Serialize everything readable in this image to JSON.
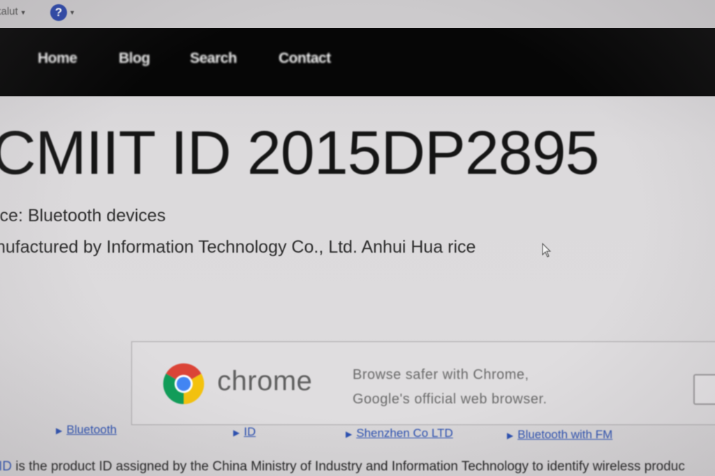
{
  "topbar": {
    "user_menu_label": "kalut",
    "help_icon_glyph": "?"
  },
  "nav": {
    "items": [
      {
        "label": "Home"
      },
      {
        "label": "Blog"
      },
      {
        "label": "Search"
      },
      {
        "label": "Contact"
      }
    ]
  },
  "main": {
    "title": "CMIIT ID 2015DP2895",
    "device_line": "ice: Bluetooth devices",
    "manufacturer_line": "nufactured by Information Technology Co., Ltd. Anhui Hua rice"
  },
  "ad": {
    "brand": "chrome",
    "line1": "Browse safer with Chrome,",
    "line2": "Google's official web browser.",
    "colors": {
      "red": "#db4437",
      "yellow": "#f4c20d",
      "green": "#0f9d58",
      "blue": "#4285f4"
    }
  },
  "related_links": [
    {
      "label": "Bluetooth"
    },
    {
      "label": "ID"
    },
    {
      "label": "Shenzhen Co LTD"
    },
    {
      "label": "Bluetooth with FM"
    }
  ],
  "footer_text": {
    "link_part": "ID",
    "rest": " is the product ID assigned by the China Ministry of Industry and Information Technology to identify wireless produc"
  }
}
